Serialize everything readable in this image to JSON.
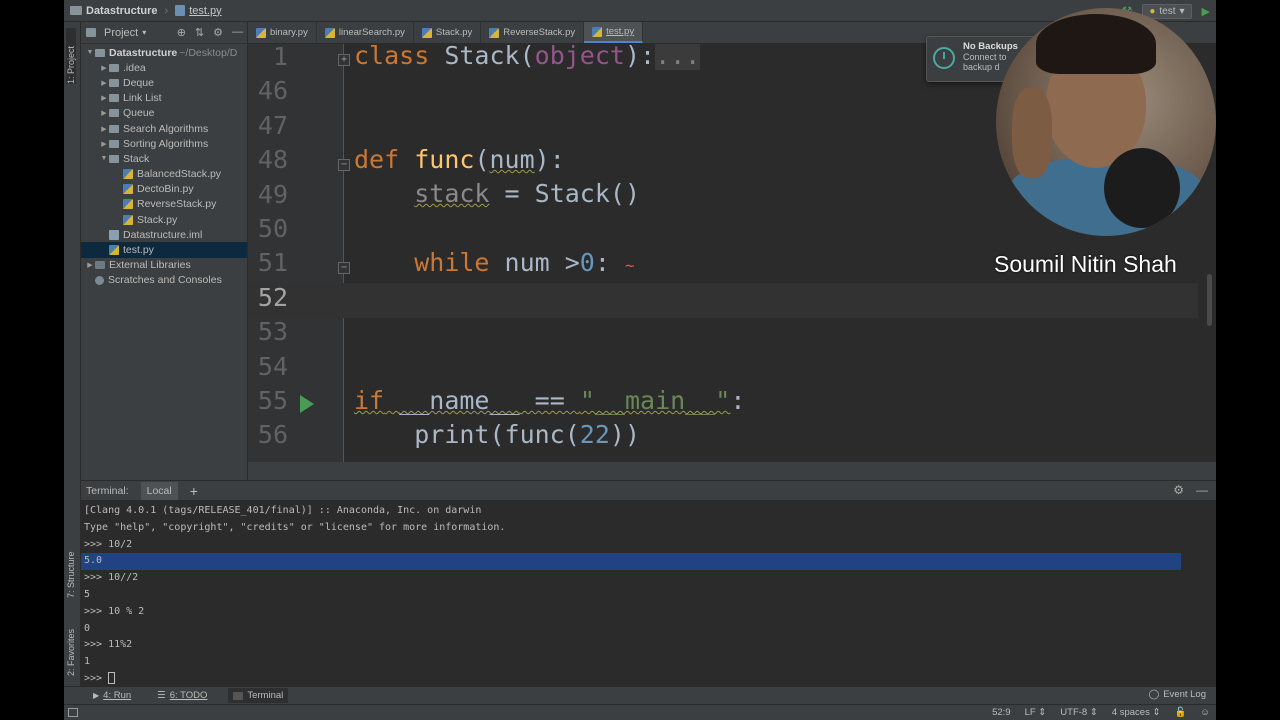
{
  "breadcrumb": {
    "project": "Datastructure",
    "file": "test.py"
  },
  "run_config": "test",
  "colors": {
    "bg_editor": "#2b2b2b",
    "bg_panel": "#3c3f41",
    "keyword": "#cc7832",
    "function": "#ffc66d",
    "number": "#6897bb",
    "string": "#6a8759",
    "selection": "#214283",
    "run_green": "#499c54"
  },
  "project_panel": {
    "title": "Project",
    "root": {
      "name": "Datastructure",
      "path": "~/Desktop/D"
    },
    "items": [
      {
        "label": ".idea",
        "type": "folder",
        "level": 1,
        "arrow": "▶"
      },
      {
        "label": "Deque",
        "type": "folder",
        "level": 1,
        "arrow": "▶"
      },
      {
        "label": "Link List",
        "type": "folder",
        "level": 1,
        "arrow": "▶"
      },
      {
        "label": "Queue",
        "type": "folder",
        "level": 1,
        "arrow": "▶"
      },
      {
        "label": "Search Algorithms",
        "type": "folder",
        "level": 1,
        "arrow": "▶"
      },
      {
        "label": "Sorting Algorithms",
        "type": "folder",
        "level": 1,
        "arrow": "▶"
      },
      {
        "label": "Stack",
        "type": "folder",
        "level": 1,
        "arrow": "▼"
      },
      {
        "label": "BalancedStack.py",
        "type": "py",
        "level": 2,
        "arrow": ""
      },
      {
        "label": "DectoBin.py",
        "type": "py",
        "level": 2,
        "arrow": ""
      },
      {
        "label": "ReverseStack.py",
        "type": "py",
        "level": 2,
        "arrow": ""
      },
      {
        "label": "Stack.py",
        "type": "py",
        "level": 2,
        "arrow": ""
      },
      {
        "label": "Datastructure.iml",
        "type": "iml",
        "level": 1,
        "arrow": ""
      },
      {
        "label": "test.py",
        "type": "py",
        "level": 1,
        "arrow": "",
        "selected": true
      },
      {
        "label": "External Libraries",
        "type": "lib",
        "level": 0,
        "arrow": "▶"
      },
      {
        "label": "Scratches and Consoles",
        "type": "scr",
        "level": 0,
        "arrow": ""
      }
    ]
  },
  "side_tabs": {
    "project": "1: Project",
    "structure": "7: Structure",
    "favorites": "2: Favorites"
  },
  "editor_tabs": [
    {
      "label": "binary.py"
    },
    {
      "label": "linearSearch.py"
    },
    {
      "label": "Stack.py"
    },
    {
      "label": "ReverseStack.py"
    },
    {
      "label": "test.py",
      "active": true
    }
  ],
  "code": {
    "line_numbers": [
      "1",
      "46",
      "47",
      "48",
      "49",
      "50",
      "51",
      "52",
      "53",
      "54",
      "55",
      "56"
    ],
    "current_line": "52",
    "line1": {
      "kw": "class",
      "name": "Stack",
      "paren_open": "(",
      "base": "object",
      "paren_close": "):",
      "fold": "..."
    },
    "line48": {
      "kw": "def",
      "name": "func",
      "open": "(",
      "param": "num",
      "close": "):"
    },
    "line49": {
      "var": "stack",
      "rest": " = Stack()"
    },
    "line51": {
      "kw": "while",
      "rest": " num >",
      "num": "0",
      "colon": ":",
      "squiggle": "~"
    },
    "line55": {
      "kw": "if",
      "dunder": "__name__",
      "op": " == ",
      "str": "\"__main__\"",
      "colon": ":"
    },
    "line56": {
      "fn": "print(func(",
      "num": "22",
      "close": "))"
    }
  },
  "notification": {
    "title": "No Backups",
    "line1": "Connect to",
    "line2": "backup d"
  },
  "presenter_name": "Soumil Nitin Shah",
  "terminal": {
    "title": "Terminal:",
    "tab": "Local",
    "lines": [
      "[Clang 4.0.1 (tags/RELEASE_401/final)] :: Anaconda, Inc. on darwin",
      "Type \"help\", \"copyright\", \"credits\" or \"license\" for more information.",
      ">>> 10/2",
      "5.0",
      ">>> 10//2",
      "5",
      ">>> 10 % 2",
      "0",
      ">>> 11%2",
      "1"
    ],
    "prompt": ">>> "
  },
  "bottom_tools": {
    "run": "4: Run",
    "todo": "6: TODO",
    "terminal": "Terminal",
    "event_log": "Event Log"
  },
  "status": {
    "position": "52:9",
    "line_sep": "LF",
    "encoding": "UTF-8",
    "indent": "4 spaces"
  }
}
